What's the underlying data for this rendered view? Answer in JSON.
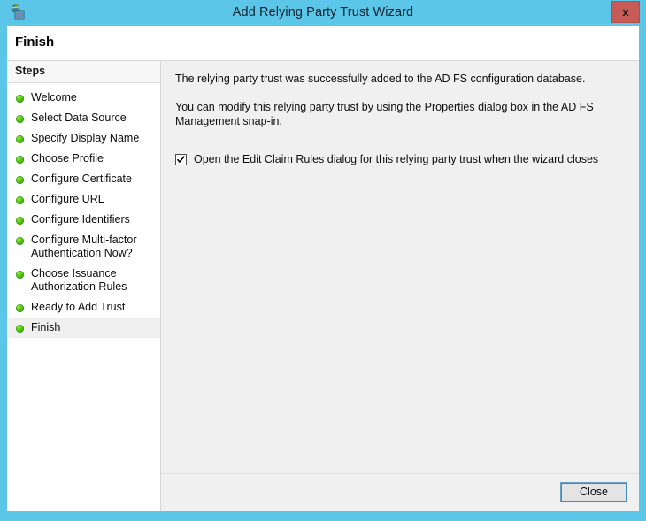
{
  "window": {
    "title": "Add Relying Party Trust Wizard",
    "icon": "adfs-relying-party-icon",
    "close_label": "x",
    "frame_color": "#5bc6e8",
    "titlebar_color": "#5bc6e8",
    "close_button_color": "#c75b56"
  },
  "header": {
    "page_title": "Finish"
  },
  "sidebar": {
    "header_label": "Steps",
    "items": [
      {
        "label": "Welcome",
        "state": "complete"
      },
      {
        "label": "Select Data Source",
        "state": "complete"
      },
      {
        "label": "Specify Display Name",
        "state": "complete"
      },
      {
        "label": "Choose Profile",
        "state": "complete"
      },
      {
        "label": "Configure Certificate",
        "state": "complete"
      },
      {
        "label": "Configure URL",
        "state": "complete"
      },
      {
        "label": "Configure Identifiers",
        "state": "complete"
      },
      {
        "label": "Configure Multi-factor\nAuthentication Now?",
        "state": "complete"
      },
      {
        "label": "Choose Issuance\nAuthorization Rules",
        "state": "complete"
      },
      {
        "label": "Ready to Add Trust",
        "state": "complete"
      },
      {
        "label": "Finish",
        "state": "current"
      }
    ]
  },
  "content": {
    "paragraph_1": "The relying party trust was successfully added to the AD FS configuration database.",
    "paragraph_2": "You can modify this relying party trust by using the Properties dialog box in the AD FS Management snap-in.",
    "checkbox": {
      "label": "Open the Edit Claim Rules dialog for this relying party trust when the wizard closes",
      "checked": true
    }
  },
  "footer": {
    "close_label": "Close"
  }
}
